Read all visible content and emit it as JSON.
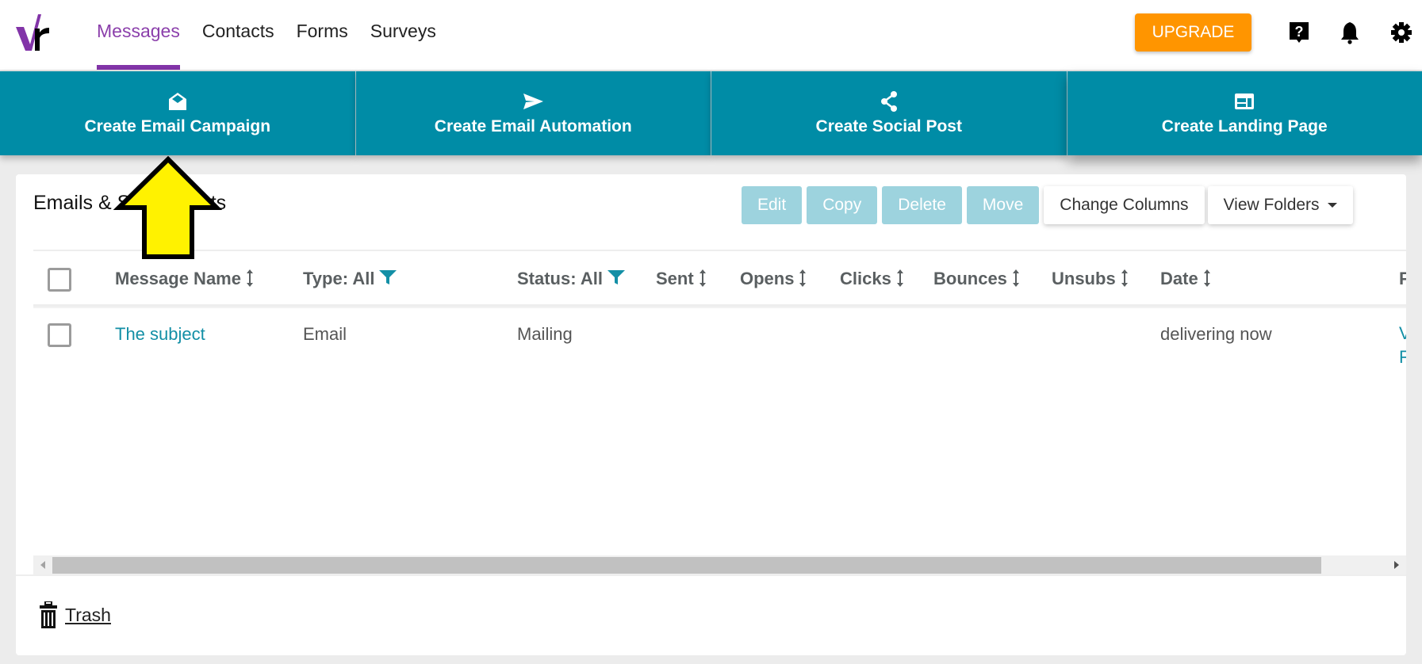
{
  "header": {
    "logo_alt": "vr",
    "nav": [
      {
        "label": "Messages",
        "active": true
      },
      {
        "label": "Contacts",
        "active": false
      },
      {
        "label": "Forms",
        "active": false
      },
      {
        "label": "Surveys",
        "active": false
      }
    ],
    "upgrade_label": "UPGRADE",
    "icons": [
      "help-icon",
      "bell-icon",
      "gear-icon"
    ]
  },
  "tiles": [
    {
      "label": "Create Email Campaign",
      "icon": "envelope-open-icon"
    },
    {
      "label": "Create Email Automation",
      "icon": "paper-plane-icon"
    },
    {
      "label": "Create Social Post",
      "icon": "share-icon"
    },
    {
      "label": "Create Landing Page",
      "icon": "web-layout-icon"
    }
  ],
  "card": {
    "title": "Emails & Social Posts",
    "toolbar": {
      "edit": "Edit",
      "copy": "Copy",
      "delete": "Delete",
      "move": "Move",
      "change_columns": "Change Columns",
      "view_folders": "View Folders"
    },
    "columns": [
      {
        "label": "Message Name",
        "control": "sort"
      },
      {
        "label": "Type: All",
        "control": "filter"
      },
      {
        "label": "Status: All",
        "control": "filter"
      },
      {
        "label": "Sent",
        "control": "sort"
      },
      {
        "label": "Opens",
        "control": "sort"
      },
      {
        "label": "Clicks",
        "control": "sort"
      },
      {
        "label": "Bounces",
        "control": "sort"
      },
      {
        "label": "Unsubs",
        "control": "sort"
      },
      {
        "label": "Date",
        "control": "sort"
      },
      {
        "label": "F",
        "control": "none"
      }
    ],
    "rows": [
      {
        "name": "The subject",
        "type": "Email",
        "status": "Mailing",
        "sent": "",
        "opens": "",
        "clicks": "",
        "bounces": "",
        "unsubs": "",
        "date": "delivering now",
        "actions": [
          "V",
          "F"
        ]
      }
    ],
    "trash_label": "Trash"
  },
  "colors": {
    "brand_purple": "#8234a8",
    "teal": "#008ca6",
    "upgrade_orange": "#ff9500",
    "disabled_button": "#9dd3de",
    "link": "#138fa6",
    "annotation_arrow": "#fff200"
  },
  "annotation": {
    "type": "arrow",
    "points_to": "Create Email Campaign"
  }
}
